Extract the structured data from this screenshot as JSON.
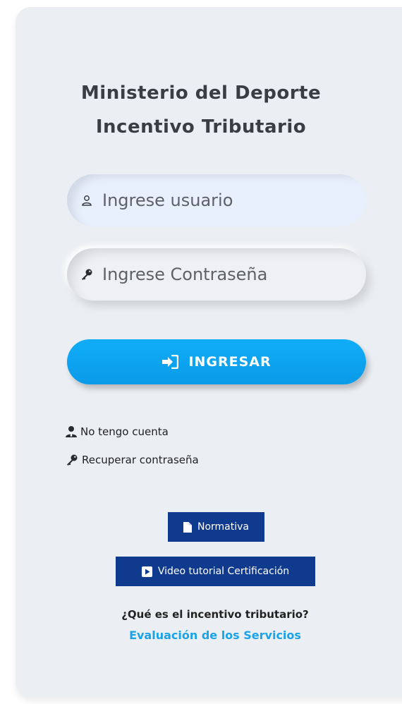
{
  "header": {
    "title_line1": "Ministerio del Deporte",
    "title_line2": "Incentivo Tributario"
  },
  "form": {
    "username_placeholder": "Ingrese usuario",
    "password_placeholder": "Ingrese Contraseña",
    "login_label": "INGRESAR"
  },
  "links": {
    "no_account": "No tengo cuenta",
    "recover_password": "Recuperar contraseña"
  },
  "resources": {
    "normativa_label": "Normativa",
    "video_label": "Video tutorial Certificación"
  },
  "footer": {
    "question": "¿Qué es el incentivo tributario?",
    "evaluation_link": "Evaluación de los Servicios"
  },
  "colors": {
    "accent": "#10adf8",
    "navy": "#103a8e",
    "link": "#1aa3e8",
    "card_bg": "#ebeef3"
  },
  "icons": {
    "username": "user-icon",
    "password": "key-icon",
    "login": "sign-in-icon",
    "no_account": "user-tie-icon",
    "recover": "key-icon",
    "normativa": "file-icon",
    "video": "play-icon"
  }
}
